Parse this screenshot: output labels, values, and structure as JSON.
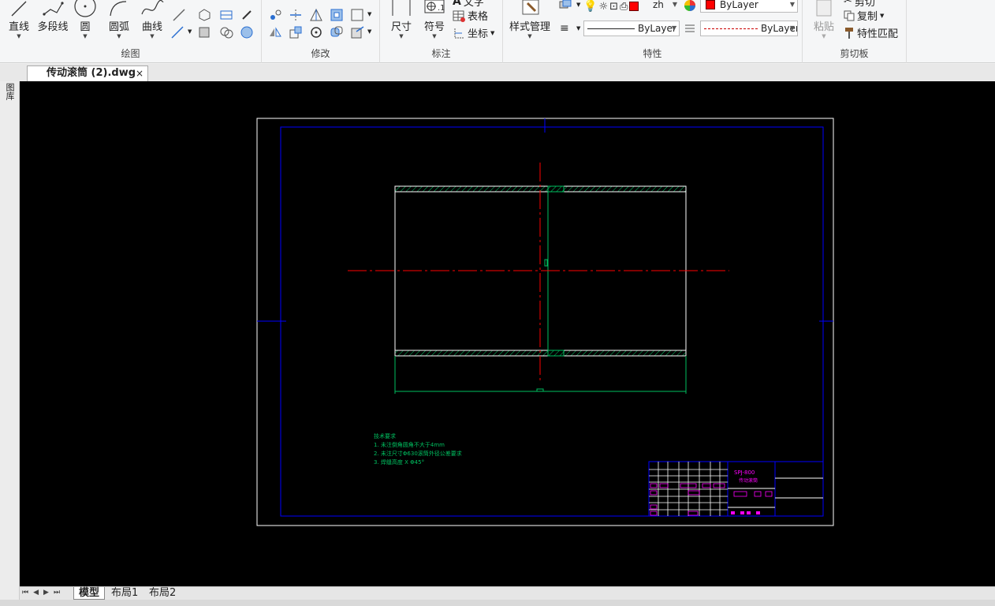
{
  "ribbon": {
    "draw": {
      "label": "绘图",
      "line": "直线",
      "polyline": "多段线",
      "circle": "圆",
      "arc": "圆弧",
      "curve": "曲线"
    },
    "modify": {
      "label": "修改"
    },
    "annotate": {
      "label": "标注",
      "dimension": "尺寸",
      "symbol": "符号",
      "text": "文字",
      "table": "表格",
      "coord": "坐标"
    },
    "properties": {
      "label": "特性",
      "style_manager": "样式管理",
      "layer_value": "zh",
      "color_value": "ByLayer",
      "linetype_value": "ByLayer",
      "lineweight_value": "ByLayer"
    },
    "clipboard": {
      "label": "剪切板",
      "paste": "粘贴",
      "cut": "剪切",
      "copy": "复制",
      "match_props": "特性匹配"
    }
  },
  "document_tab": {
    "title": "传动滚筒 (2).dwg",
    "close": "×"
  },
  "left_panel": {
    "label": "图库"
  },
  "drawing": {
    "notes_title": "技术要求",
    "notes": [
      "1. 未注倒角圆角不大于4mm",
      "2. 未注尺寸Φ630滚筒外径公差要求",
      "3. 焊缝高度 X Φ45°"
    ],
    "title_block_code": "SPJ-800",
    "title_block_name": "传动滚筒"
  },
  "layout_tabs": [
    "模型",
    "布局1",
    "布局2"
  ],
  "nav_buttons": "⏮◀▶⏭",
  "colors": {
    "canvas_bg": "#000000",
    "frame_white": "#ffffff",
    "frame_blue": "#0000ff",
    "center_red": "#ff0000",
    "hatch_green": "#00ff80",
    "text_green": "#00c060",
    "magenta": "#ff00ff"
  }
}
